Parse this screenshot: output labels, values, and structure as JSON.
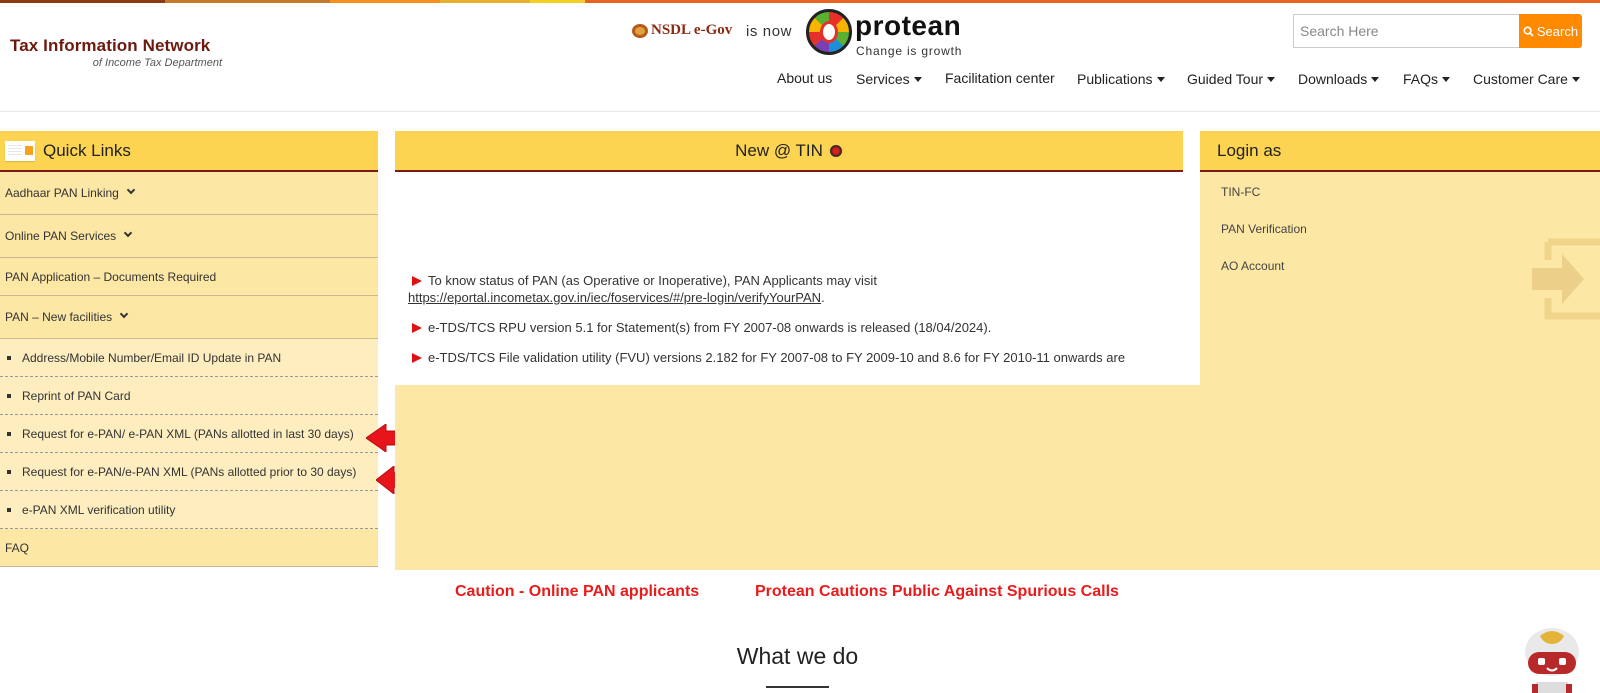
{
  "brand": {
    "title": "Tax Information Network",
    "subtitle": "of Income Tax Department"
  },
  "header_banner": {
    "nsdl_text": "NSDL e-Gov",
    "is_now": "is now",
    "protean_name": "protean",
    "protean_tagline": "Change is growth"
  },
  "search": {
    "placeholder": "Search Here",
    "button_label": "Search"
  },
  "nav": {
    "items": [
      {
        "label": "About us",
        "dropdown": false
      },
      {
        "label": "Services",
        "dropdown": true
      },
      {
        "label": "Facilitation center",
        "dropdown": false
      },
      {
        "label": "Publications",
        "dropdown": true
      },
      {
        "label": "Guided Tour",
        "dropdown": true
      },
      {
        "label": "Downloads",
        "dropdown": true
      },
      {
        "label": "FAQs",
        "dropdown": true
      },
      {
        "label": "Customer Care",
        "dropdown": true
      }
    ]
  },
  "quick_links": {
    "title": "Quick Links",
    "items": [
      {
        "label": "Aadhaar PAN Linking",
        "expandable": true
      },
      {
        "label": "Online PAN Services",
        "expandable": true
      },
      {
        "label": "PAN Application – Documents Required",
        "expandable": false
      },
      {
        "label": "PAN – New facilities",
        "expandable": true
      }
    ],
    "sub_items": [
      {
        "label": "Address/Mobile Number/Email ID Update in PAN"
      },
      {
        "label": "Reprint of PAN Card"
      },
      {
        "label": "Request for e-PAN/ e-PAN XML (PANs allotted in last 30 days)"
      },
      {
        "label": "Request for e-PAN/e-PAN XML (PANs allotted prior to 30 days)"
      },
      {
        "label": "e-PAN XML verification utility"
      }
    ],
    "faq_label": "FAQ"
  },
  "news": {
    "title": "New @ TIN",
    "items": [
      {
        "text": "To know status of PAN (as Operative or Inoperative), PAN Applicants may visit",
        "link": "https://eportal.incometax.gov.in/iec/foservices/#/pre-login/verifyYourPAN",
        "suffix": "."
      },
      {
        "text": "e-TDS/TCS RPU version 5.1 for Statement(s) from FY 2007-08 onwards is released (18/04/2024)."
      },
      {
        "text": "e-TDS/TCS File validation utility (FVU) versions 2.182 for FY 2007-08 to FY 2009-10 and 8.6 for FY 2010-11 onwards are"
      }
    ]
  },
  "login": {
    "title": "Login as",
    "items": [
      "TIN-FC",
      "PAN Verification",
      "AO Account"
    ]
  },
  "cautions": {
    "left": "Caution - Online PAN applicants",
    "right": "Protean Cautions Public Against Spurious Calls"
  },
  "section": {
    "what_we_do": "What we do"
  },
  "colors": {
    "brand_maroon": "#6b1a0d",
    "panel_header": "#fdd451",
    "panel_body": "#fde7a5",
    "search_orange": "#ff8a00",
    "caution_red": "#e81c1c",
    "arrow_red": "#e8141c"
  }
}
